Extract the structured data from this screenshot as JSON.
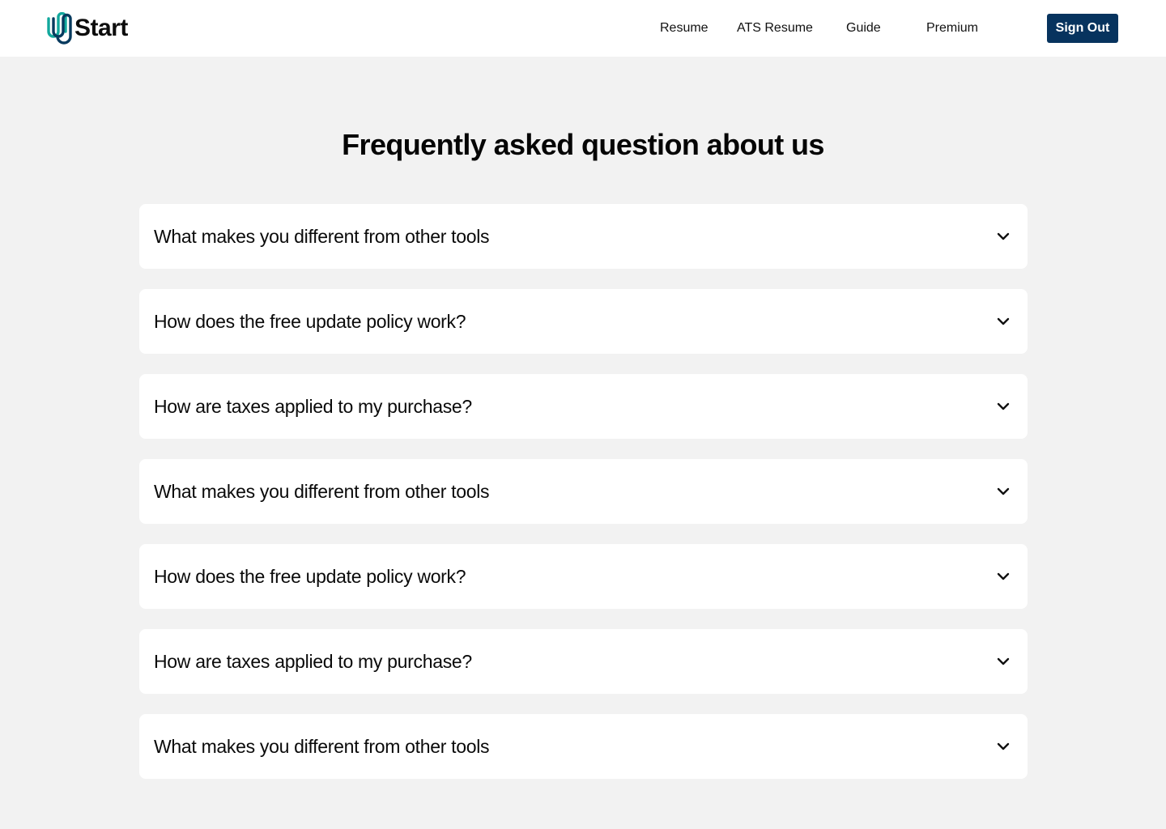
{
  "header": {
    "logo_text": "Start",
    "logo_icon": "u-logo-icon",
    "nav": [
      {
        "label": "Resume"
      },
      {
        "label": "ATS Resume"
      },
      {
        "label": "Guide"
      },
      {
        "label": "Premium"
      }
    ],
    "sign_out_label": "Sign Out"
  },
  "faq": {
    "title": "Frequently asked question about us",
    "items": [
      {
        "question": "What makes you different from other tools"
      },
      {
        "question": "How does the free update policy work?"
      },
      {
        "question": "How are taxes applied to my purchase?"
      },
      {
        "question": "What makes you different from other tools"
      },
      {
        "question": "How does the free update policy work?"
      },
      {
        "question": "How are taxes applied to my purchase?"
      },
      {
        "question": "What makes you different from other tools"
      }
    ],
    "expand_icon": "chevron-down-icon"
  },
  "colors": {
    "background": "#f2f2f2",
    "header_bg": "#ffffff",
    "button_bg": "#07335e",
    "logo_teal": "#12a89d",
    "logo_navy": "#073a5e"
  }
}
